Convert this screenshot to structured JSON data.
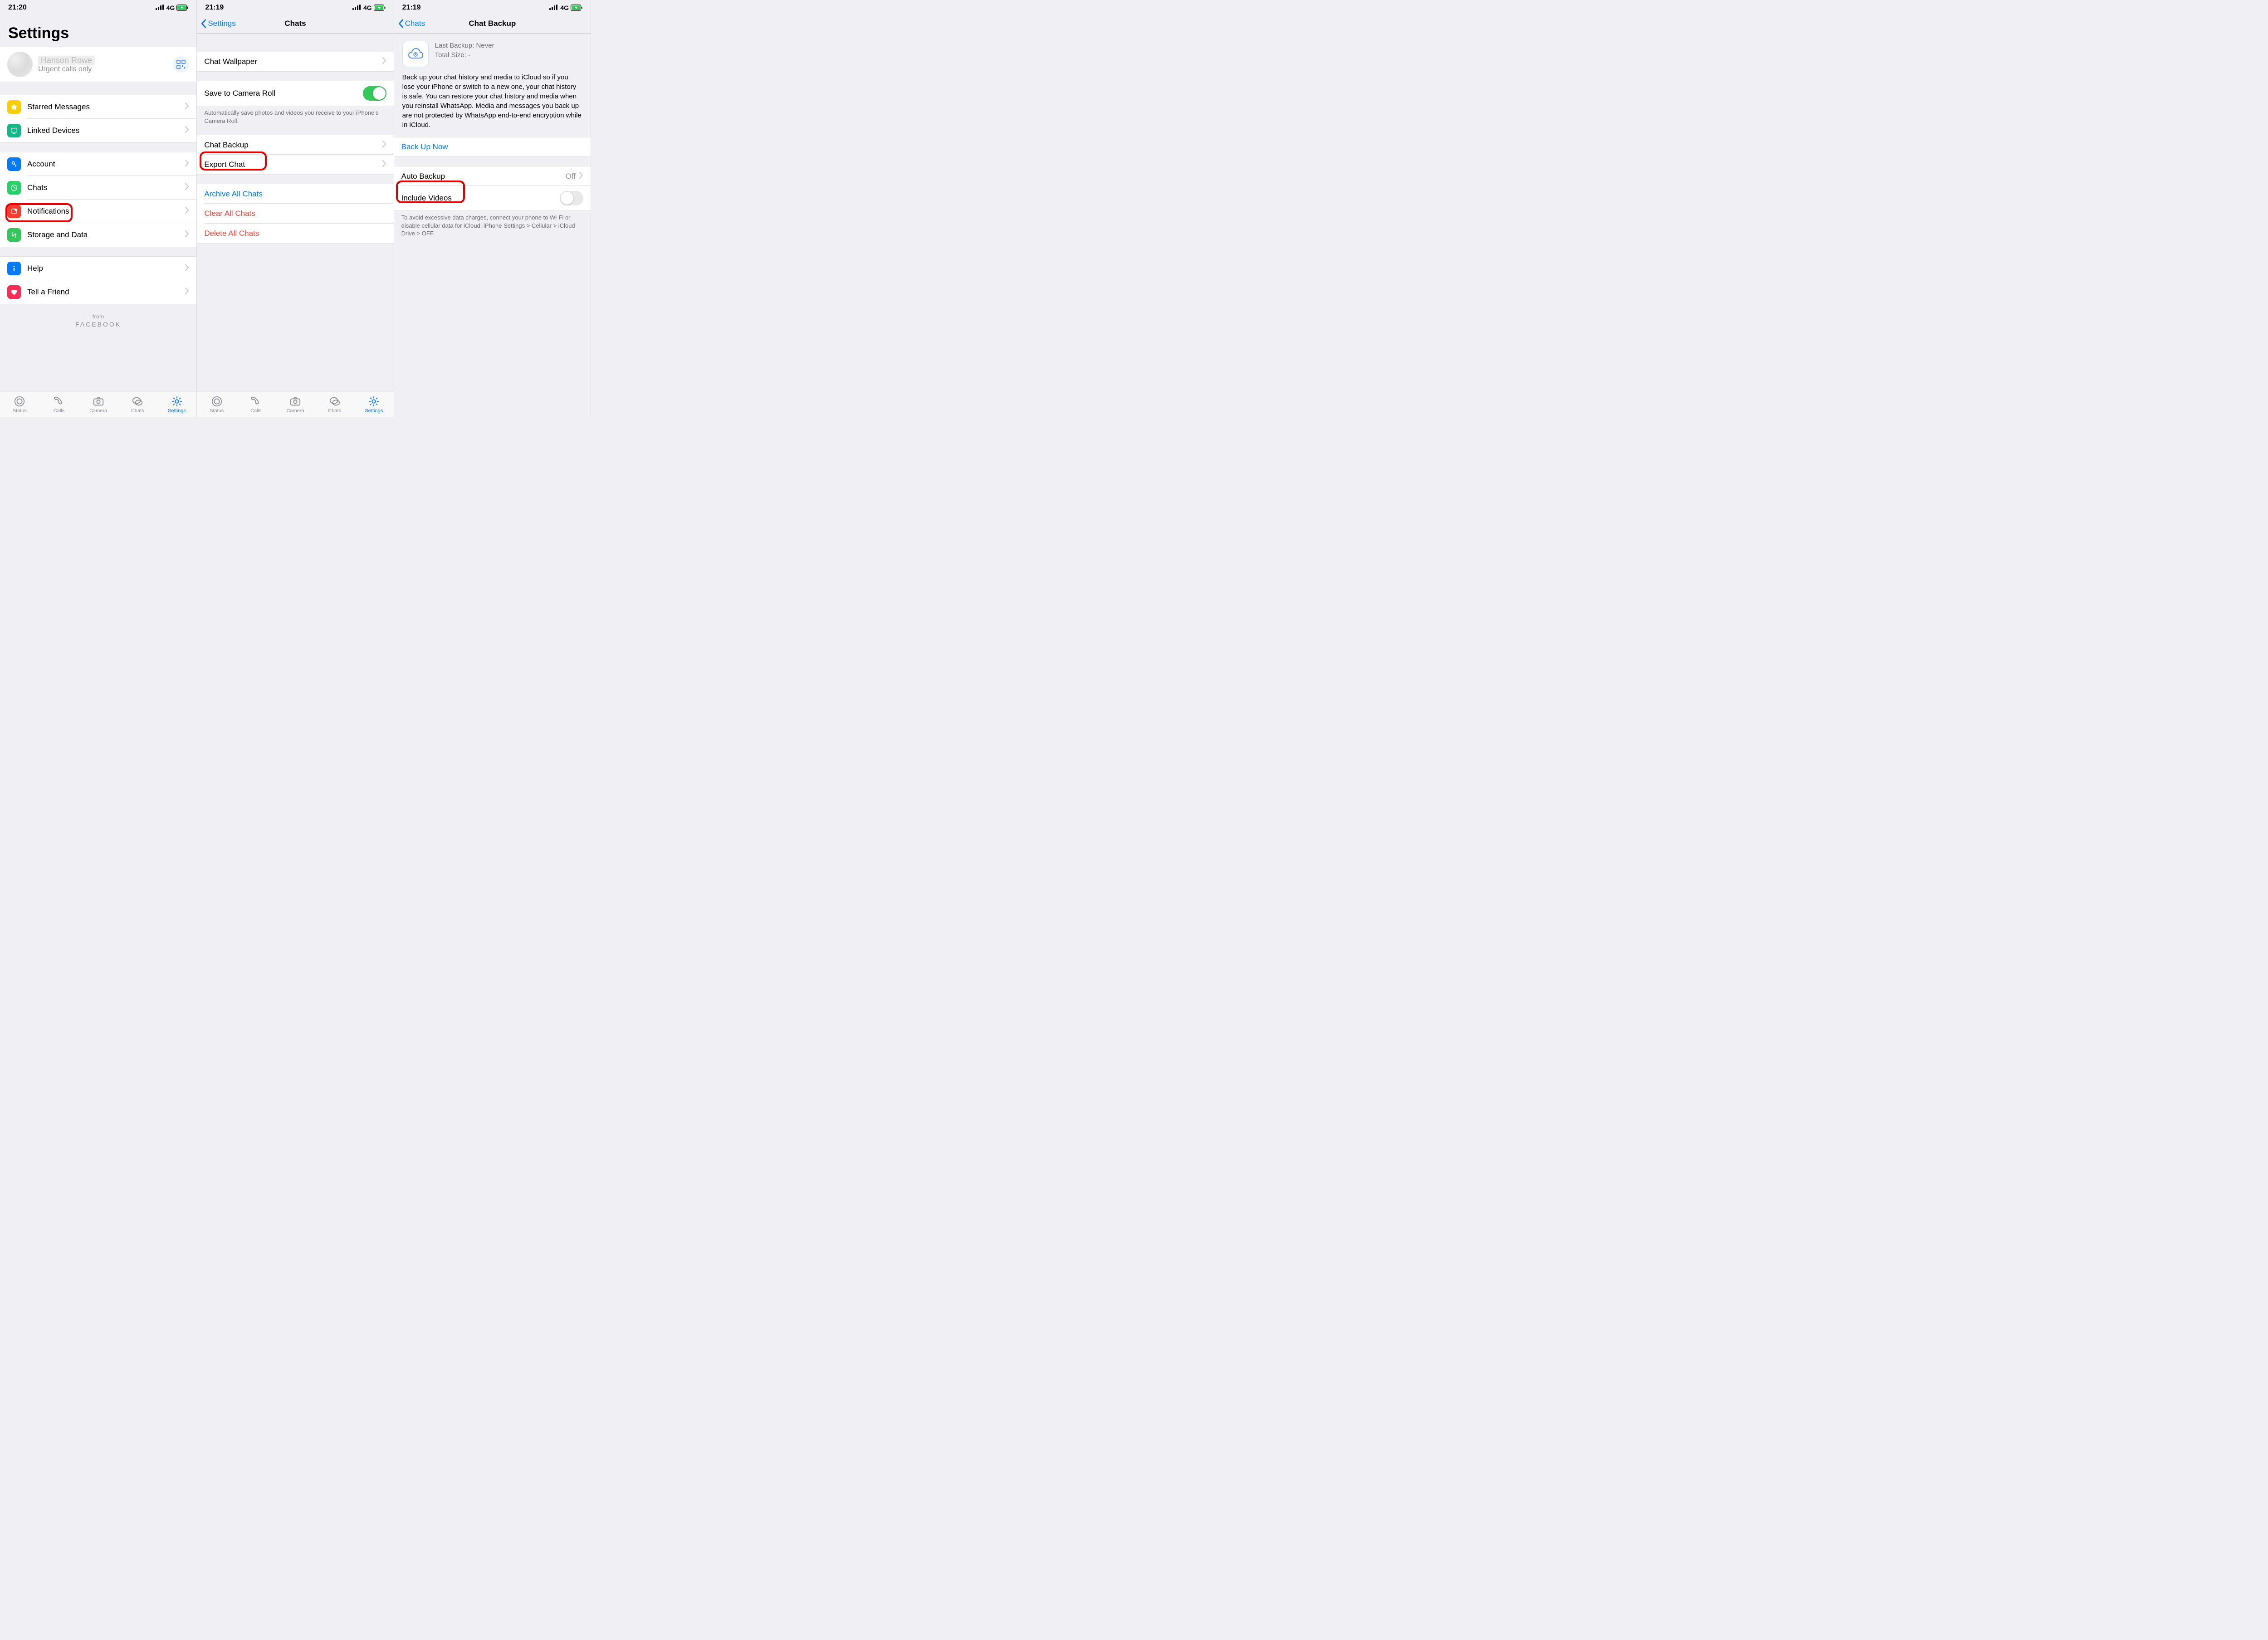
{
  "status": {
    "net_label": "4G"
  },
  "tabs": {
    "status": "Status",
    "calls": "Calls",
    "camera": "Camera",
    "chats": "Chats",
    "settings": "Settings"
  },
  "screen1": {
    "time": "21:20",
    "title": "Settings",
    "profile": {
      "name": "Hanson Rowe",
      "status": "Urgent calls only"
    },
    "items": {
      "starred": "Starred Messages",
      "linked": "Linked Devices",
      "account": "Account",
      "chats": "Chats",
      "notifications": "Notifications",
      "storage": "Storage and Data",
      "help": "Help",
      "tell": "Tell a Friend"
    },
    "footer": {
      "from": "from",
      "brand": "FACEBOOK"
    }
  },
  "screen2": {
    "time": "21:19",
    "back": "Settings",
    "title": "Chats",
    "items": {
      "wallpaper": "Chat Wallpaper",
      "camera_roll": "Save to Camera Roll",
      "camera_roll_note": "Automatically save photos and videos you receive to your iPhone's Camera Roll.",
      "backup": "Chat Backup",
      "export": "Export Chat",
      "archive": "Archive All Chats",
      "clear": "Clear All Chats",
      "delete": "Delete All Chats"
    }
  },
  "screen3": {
    "time": "21:19",
    "back": "Chats",
    "title": "Chat Backup",
    "info": {
      "last_label": "Last Backup: ",
      "last_value": "Never",
      "size_label": "Total Size: ",
      "size_value": "-"
    },
    "desc": "Back up your chat history and media to iCloud so if you lose your iPhone or switch to a new one, your chat history is safe. You can restore your chat history and media when you reinstall WhatsApp. Media and messages you back up are not protected by WhatsApp end-to-end encryption while in iCloud.",
    "backup_now": "Back Up Now",
    "auto": {
      "label": "Auto Backup",
      "value": "Off"
    },
    "videos": "Include Videos",
    "note": "To avoid excessive data charges, connect your phone to Wi-Fi or disable cellular data for iCloud: iPhone Settings > Cellular > iCloud Drive > OFF."
  }
}
